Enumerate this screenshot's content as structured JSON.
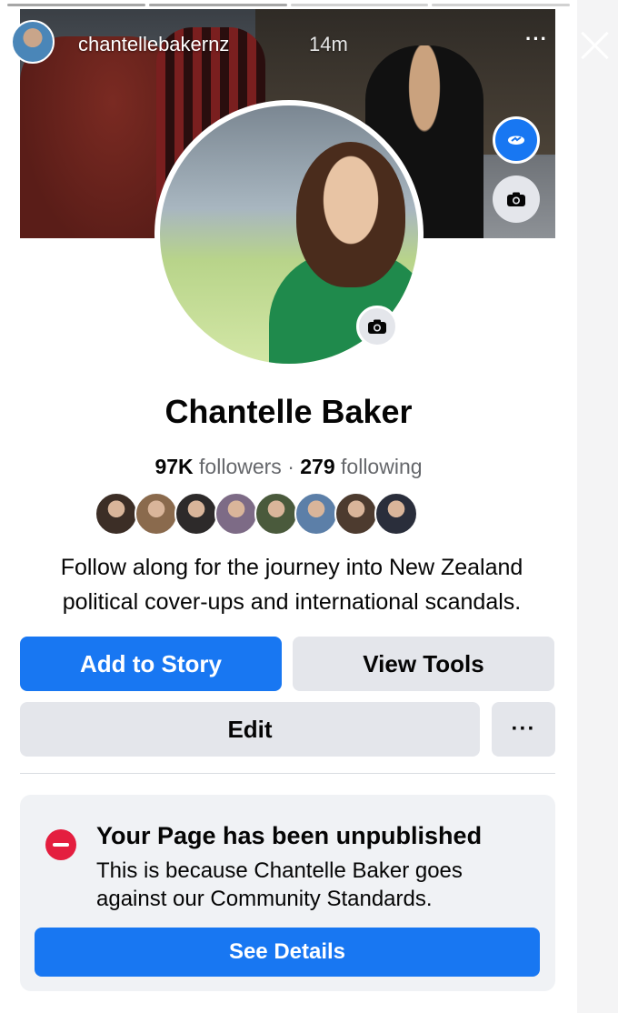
{
  "story": {
    "username": "chantellebakernz",
    "time": "14m",
    "more_label": "···",
    "progress_segments": 4
  },
  "profile": {
    "name": "Chantelle Baker",
    "followers_count": "97K",
    "followers_label": "followers",
    "separator": "·",
    "following_count": "279",
    "following_label": "following",
    "bio": "Follow along for the journey into New Zealand political cover-ups and international scandals."
  },
  "friends": [
    {
      "color": "#3c2e26"
    },
    {
      "color": "#8a6a4d"
    },
    {
      "color": "#2d2a2a"
    },
    {
      "color": "#7d6b86"
    },
    {
      "color": "#4a5a3c"
    },
    {
      "color": "#5c7fa8"
    },
    {
      "color": "#4d3b2f"
    },
    {
      "color": "#2a2e3b"
    }
  ],
  "actions": {
    "add_to_story": "Add to Story",
    "view_tools": "View Tools",
    "edit": "Edit",
    "more": "···"
  },
  "notice": {
    "title": "Your Page has been unpublished",
    "body": "This is because Chantelle Baker goes against our Community Standards.",
    "button": "See Details"
  },
  "colors": {
    "primary": "#1877f2",
    "secondary_button": "#e4e6eb",
    "danger": "#e41e3f",
    "notice_bg": "#f0f2f5"
  }
}
